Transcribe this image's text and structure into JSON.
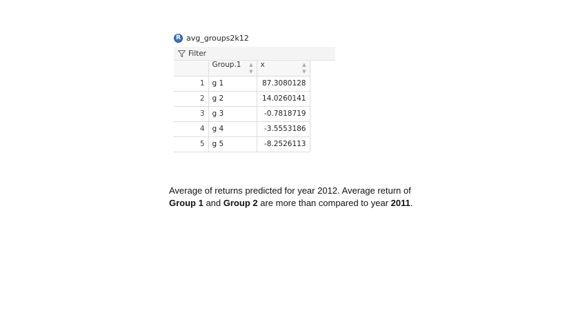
{
  "viewer": {
    "icon_letter": "R",
    "title": "avg_groups2k12",
    "filter_label": "Filter",
    "columns": [
      "",
      "Group.1",
      "x"
    ],
    "rows": [
      {
        "index": "1",
        "group": "g 1",
        "x": "87.3080128"
      },
      {
        "index": "2",
        "group": "g 2",
        "x": "14.0260141"
      },
      {
        "index": "3",
        "group": "g 3",
        "x": "-0.7818719"
      },
      {
        "index": "4",
        "group": "g 4",
        "x": "-3.5553186"
      },
      {
        "index": "5",
        "group": "g 5",
        "x": "-8.2526113"
      }
    ]
  },
  "caption": {
    "part1": "Average of returns predicted for year 2012. Average return of ",
    "bold1": "Group 1",
    "part2": " and ",
    "bold2": "Group 2",
    "part3": " are more than compared to year ",
    "bold3": "2011",
    "part4": "."
  }
}
